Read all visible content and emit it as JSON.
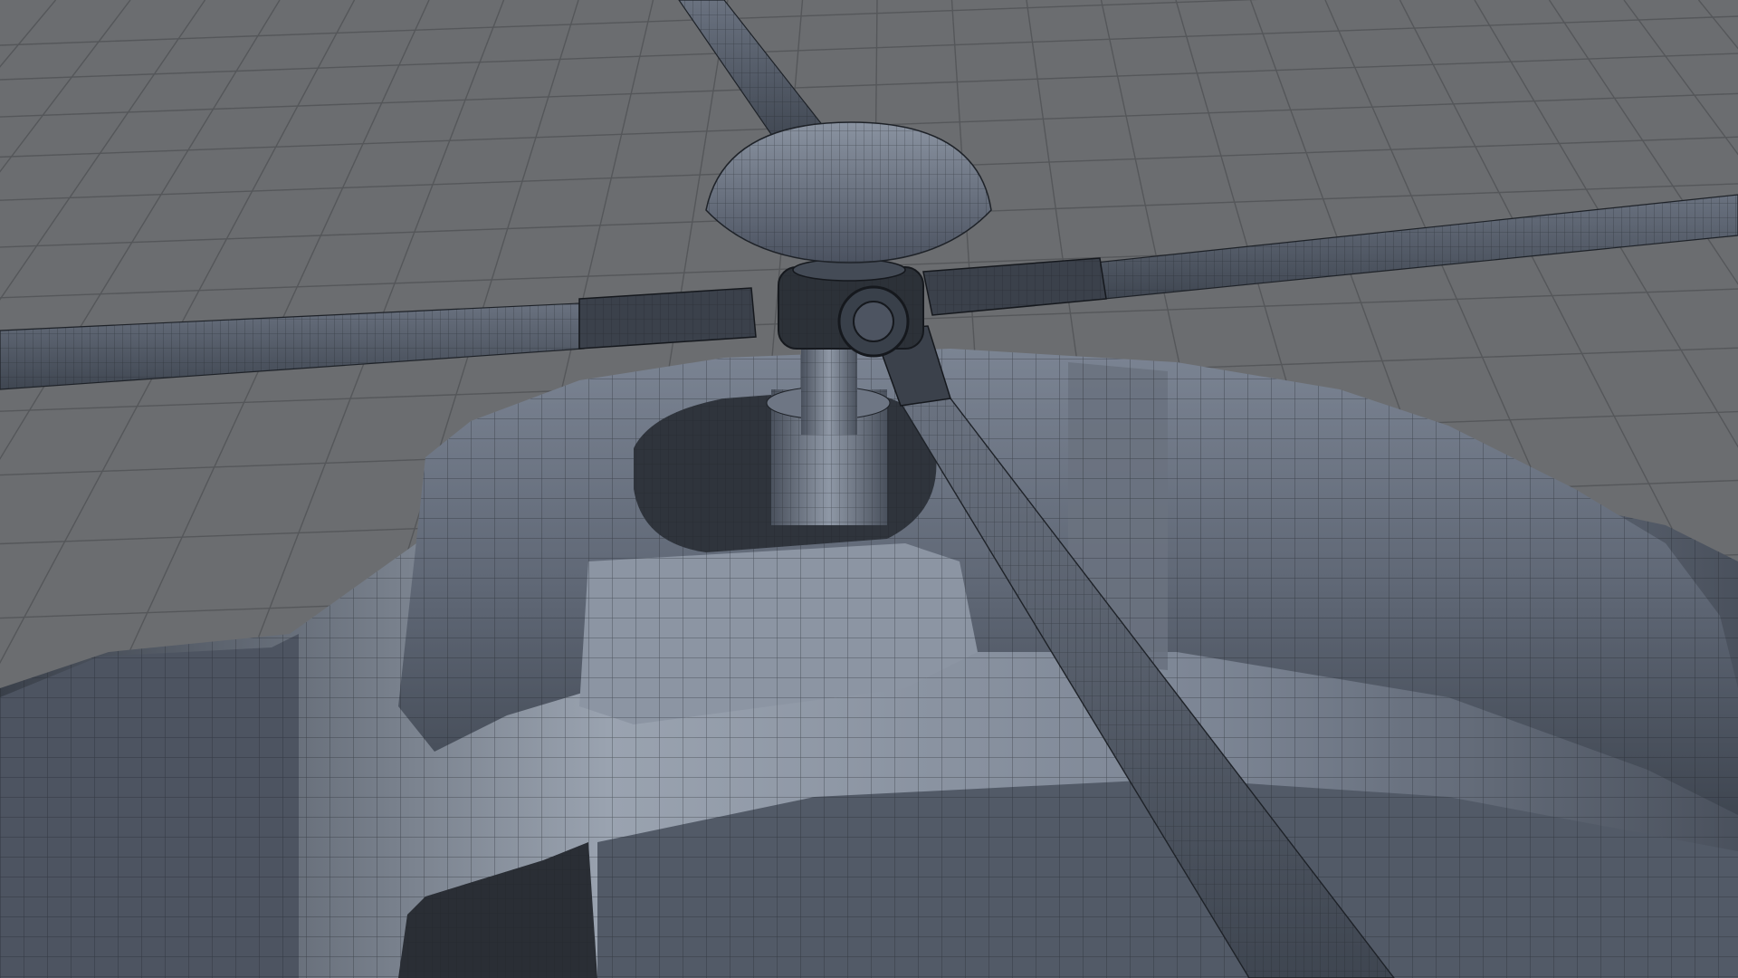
{
  "scene": {
    "kind": "3d-viewport-wireframe-render",
    "subject": "helicopter-main-rotor-hub-and-fuselage",
    "shading": "smooth-shaded-with-wireframe-on-shaded",
    "grid": true,
    "colors": {
      "background": "#6b6d70",
      "grid_line": "#55575a",
      "model_base": "#4e5563",
      "model_light": "#8f98a6",
      "model_dark": "#2f343c",
      "wire": "#1e2228"
    }
  }
}
